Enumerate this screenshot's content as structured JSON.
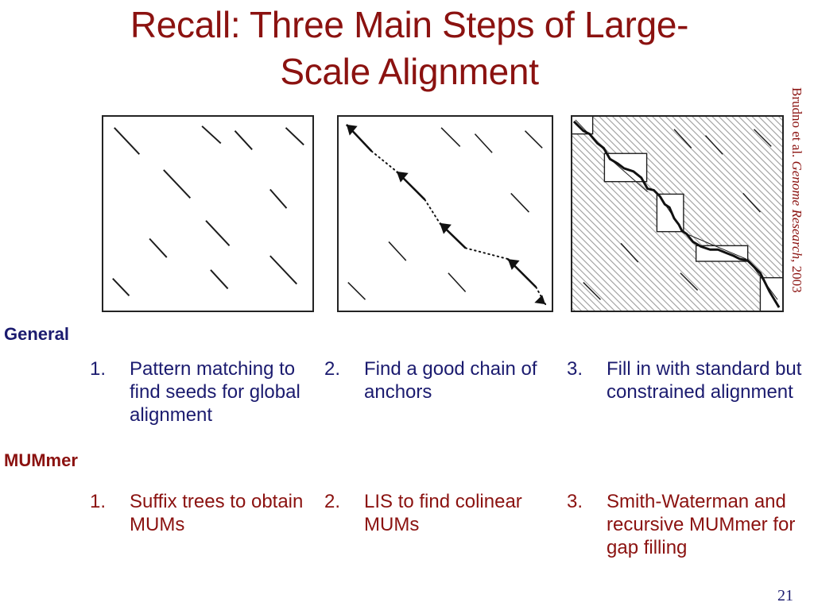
{
  "slide": {
    "title": "Recall: Three Main Steps of Large-\nScale Alignment",
    "page_number": "21",
    "credit_prefix": "Brudno et al. ",
    "credit_italic": "Genome Research",
    "credit_suffix": ", 2003",
    "title_color": "#8b1210",
    "general_color": "#1b1b6f",
    "mummer_color": "#8b1210"
  },
  "figures": [
    {
      "name": "seeds-dotplot",
      "caption_step": "1",
      "description": "Dot plot with scattered short diagonal seed matches"
    },
    {
      "name": "anchor-chain-dotplot",
      "caption_step": "2",
      "description": "Dot plot with a chain of anchors linked by dotted arrows"
    },
    {
      "name": "constrained-alignment-dotplot",
      "caption_step": "3",
      "description": "Hatched dot plot with white gap boxes and a filled alignment path"
    }
  ],
  "rows": [
    {
      "label": "General",
      "steps": [
        {
          "num": "1.",
          "text": "Pattern matching to find seeds for global alignment"
        },
        {
          "num": "2.",
          "text": "Find a good chain of anchors"
        },
        {
          "num": "3.",
          "text": "Fill in with standard but constrained alignment"
        }
      ]
    },
    {
      "label": "MUMmer",
      "steps": [
        {
          "num": "1.",
          "text": "Suffix trees to obtain MUMs"
        },
        {
          "num": "2.",
          "text": "LIS to find colinear MUMs"
        },
        {
          "num": "3.",
          "text": "Smith-Waterman and recursive MUMmer for gap filling"
        }
      ]
    }
  ]
}
